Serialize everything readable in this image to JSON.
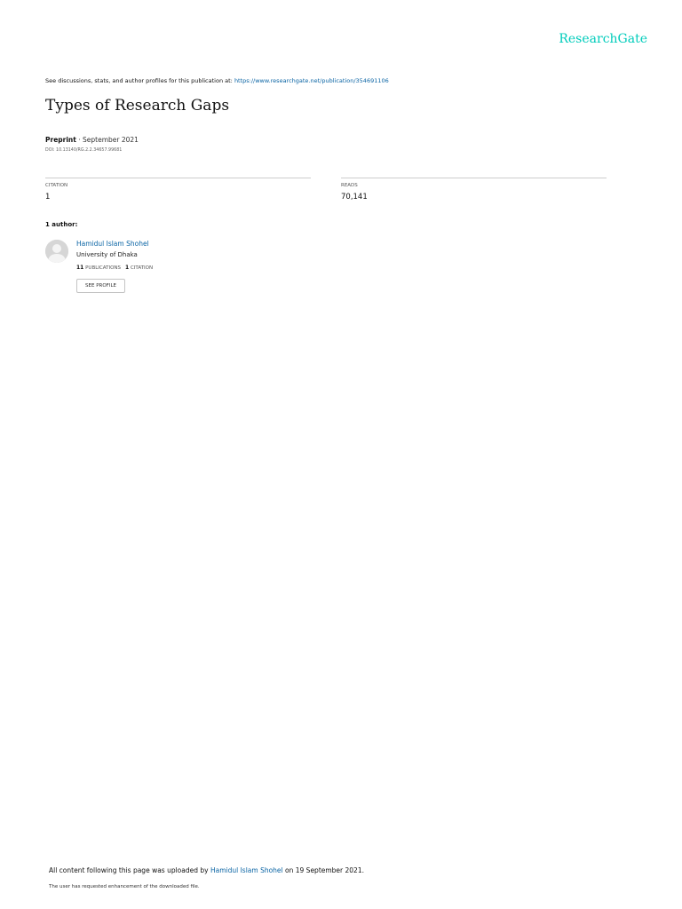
{
  "brand": {
    "name": "ResearchGate",
    "color": "#00ccbb"
  },
  "header": {
    "discussion_prefix": "See discussions, stats, and author profiles for this publication at: ",
    "publication_url": "https://www.researchgate.net/publication/354691106"
  },
  "publication": {
    "title": "Types of Research Gaps",
    "type": "Preprint",
    "separator": " · ",
    "date": "September 2021",
    "doi": "DOI: 10.13140/RG.2.2.34657.99681"
  },
  "stats": {
    "citations_label": "CITATION",
    "citations_value": "1",
    "reads_label": "READS",
    "reads_value": "70,141"
  },
  "authors": {
    "heading": "1 author:",
    "items": [
      {
        "name": "Hamidul Islam Shohel",
        "institution": "University of Dhaka",
        "publications_count": "11",
        "publications_label": "PUBLICATIONS",
        "citations_count": "1",
        "citations_label": "CITATION",
        "see_profile_label": "SEE PROFILE",
        "avatar_icon": "person-placeholder-icon"
      }
    ]
  },
  "footer": {
    "upload_prefix": "All content following this page was uploaded by ",
    "uploader": "Hamidul Islam Shohel",
    "upload_suffix": " on 19 September 2021.",
    "note": "The user has requested enhancement of the downloaded file."
  },
  "colors": {
    "link": "#0a64a4",
    "rule": "#cccccc"
  }
}
